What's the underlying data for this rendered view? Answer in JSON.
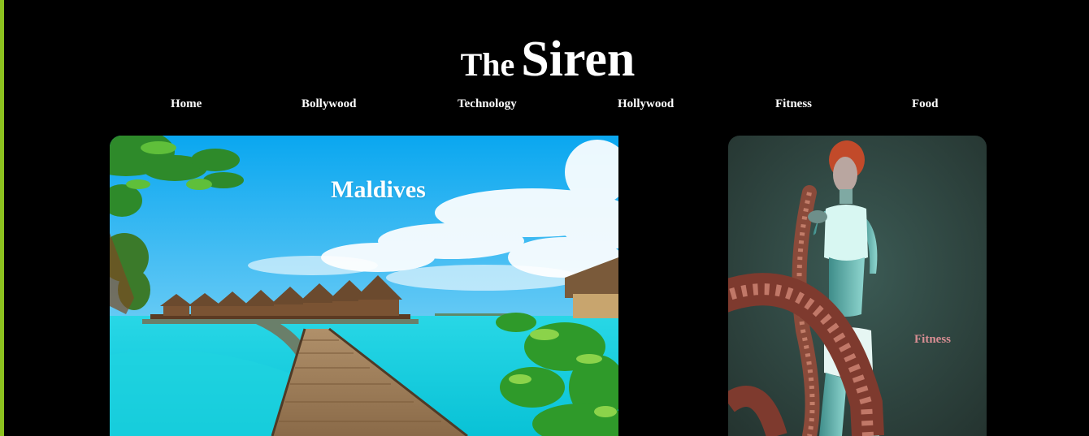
{
  "brand": {
    "prefix": "The",
    "name": "Siren"
  },
  "nav": {
    "items": [
      {
        "label": "Home"
      },
      {
        "label": "Bollywood"
      },
      {
        "label": "Technology"
      },
      {
        "label": "Hollywood"
      },
      {
        "label": "Fitness"
      },
      {
        "label": "Food"
      }
    ]
  },
  "cards": {
    "featured": {
      "title": "Maldives",
      "image": "maldives-overwater-bungalows-photo"
    },
    "side": {
      "label": "Fitness",
      "image": "woman-battle-ropes-workout-photo"
    }
  },
  "colors": {
    "background": "#000000",
    "text": "#ffffff",
    "accent_rule": "#8cc21f",
    "fitness_label": "#d88e93"
  }
}
